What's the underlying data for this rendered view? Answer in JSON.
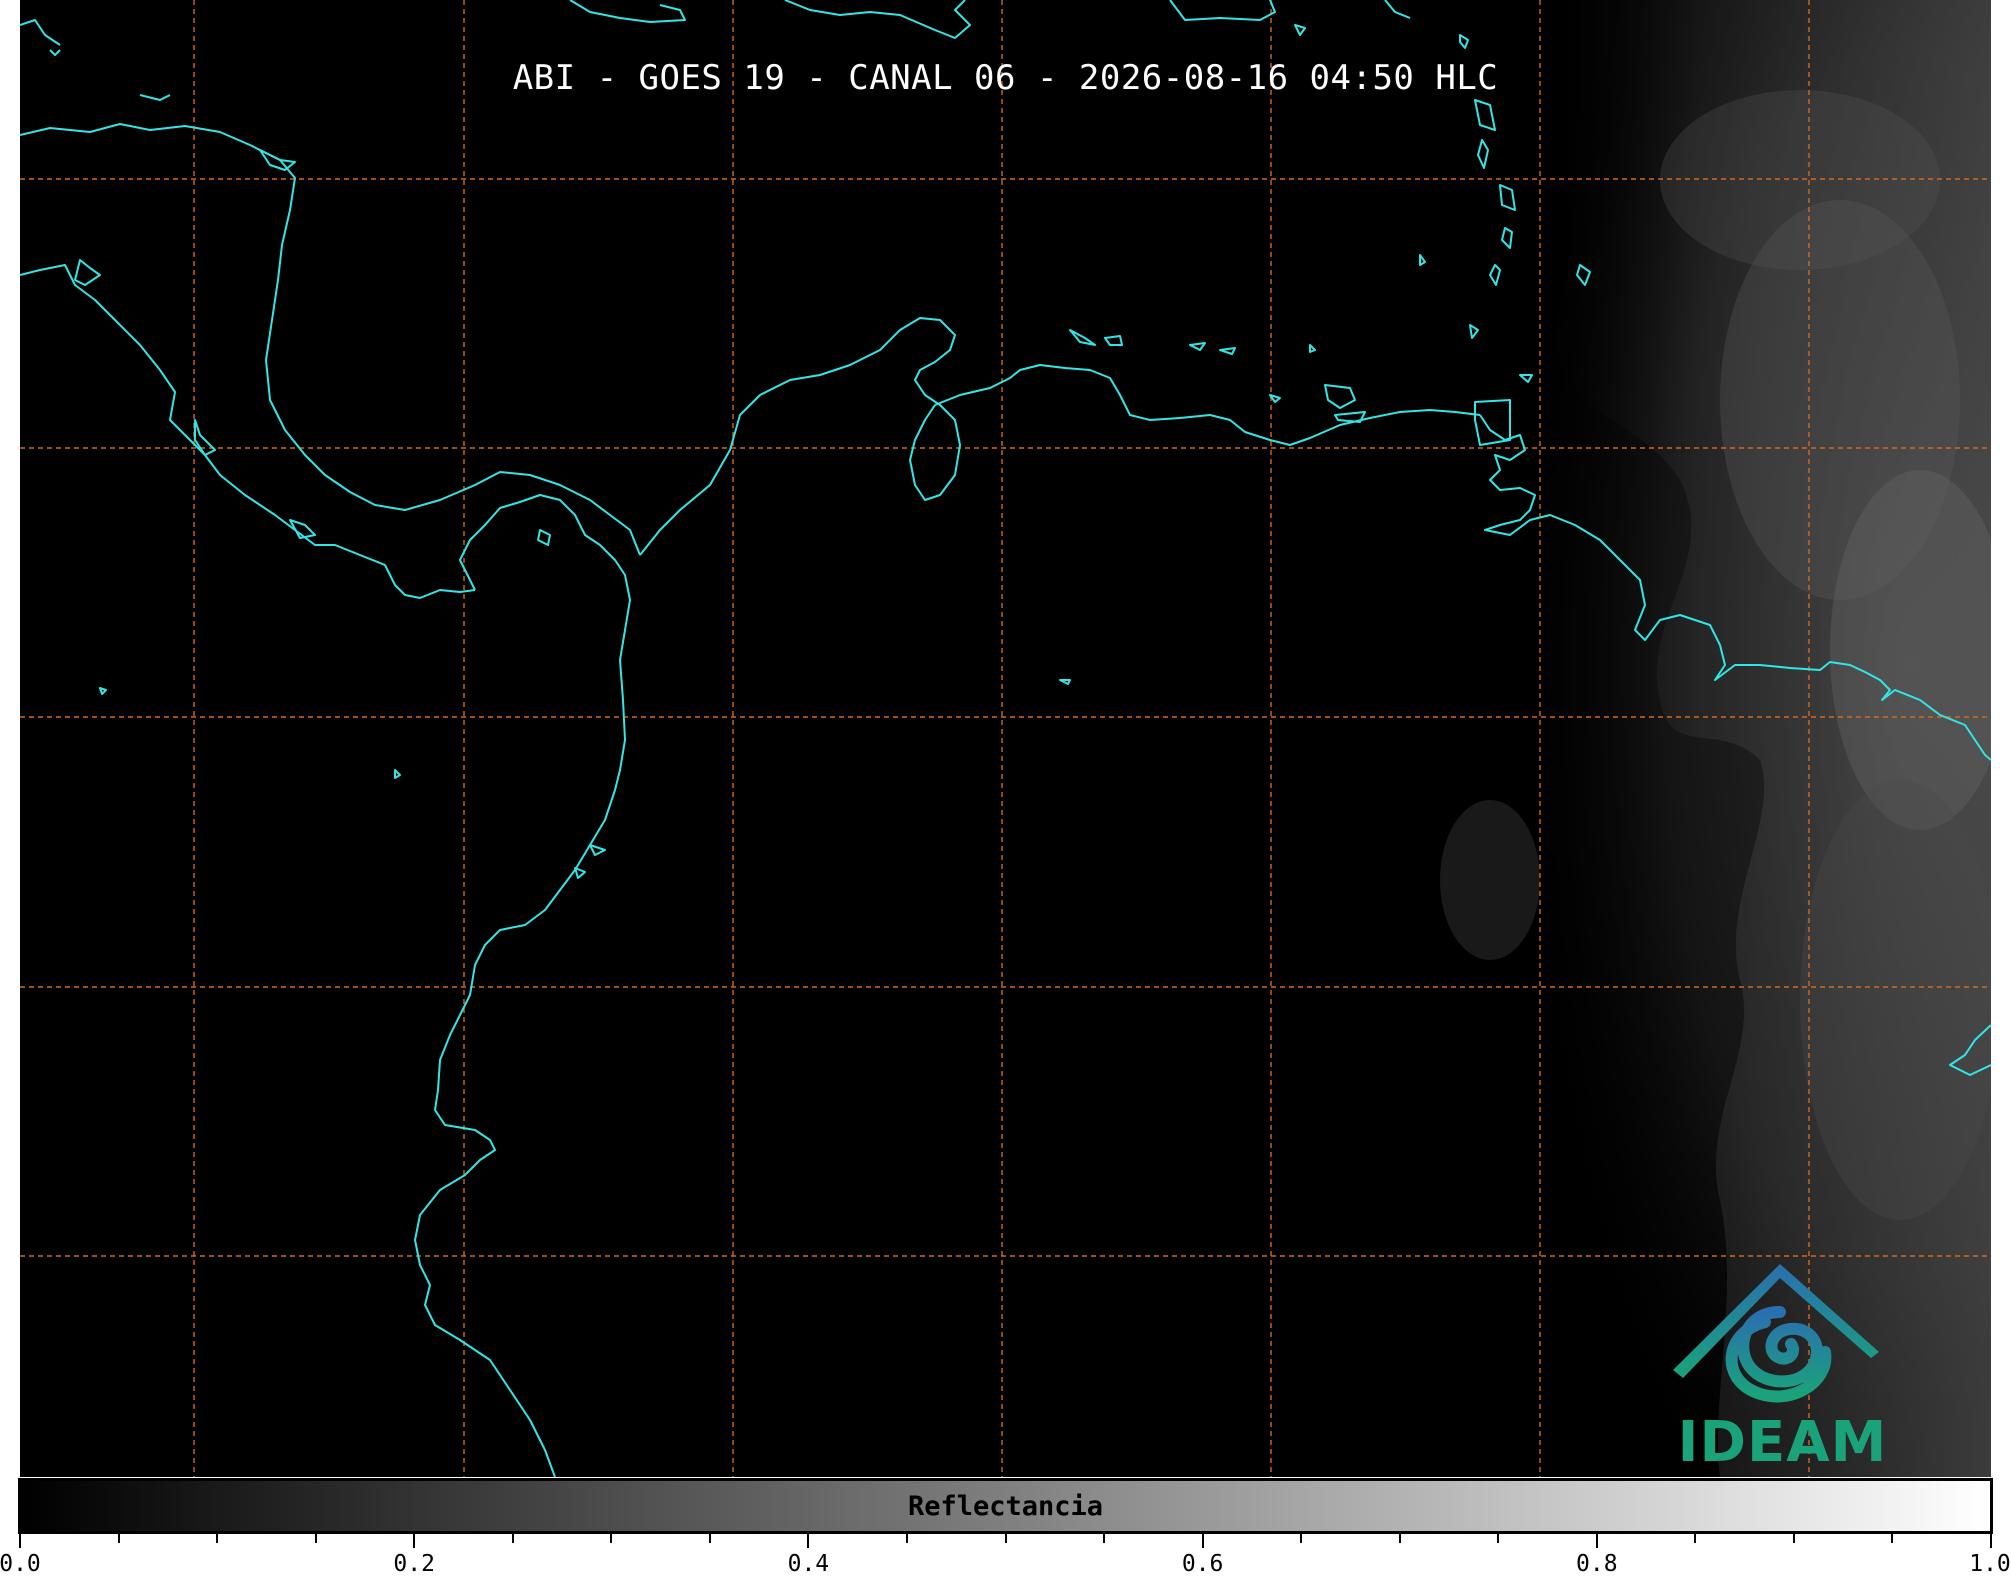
{
  "map": {
    "title": "ABI - GOES 19 - CANAL 06 - 2026-08-16 04:50 HLC",
    "background_color": "#000000",
    "coastline_color": "#33e6e6",
    "grid_color": "#d2691e",
    "logo": {
      "text": "IDEAM",
      "text_color": "#1aa37a",
      "icon": "ideam-logo-icon"
    }
  },
  "colorbar": {
    "label": "Reflectancia",
    "range": [
      0.0,
      1.0
    ],
    "colormap": [
      "#000000",
      "#ffffff"
    ],
    "ticks": [
      "0.0",
      "0.2",
      "0.4",
      "0.6",
      "0.8",
      "1.0"
    ],
    "tick_values": [
      0.0,
      0.2,
      0.4,
      0.6,
      0.8,
      1.0
    ],
    "minor_tick_step": 0.05
  }
}
